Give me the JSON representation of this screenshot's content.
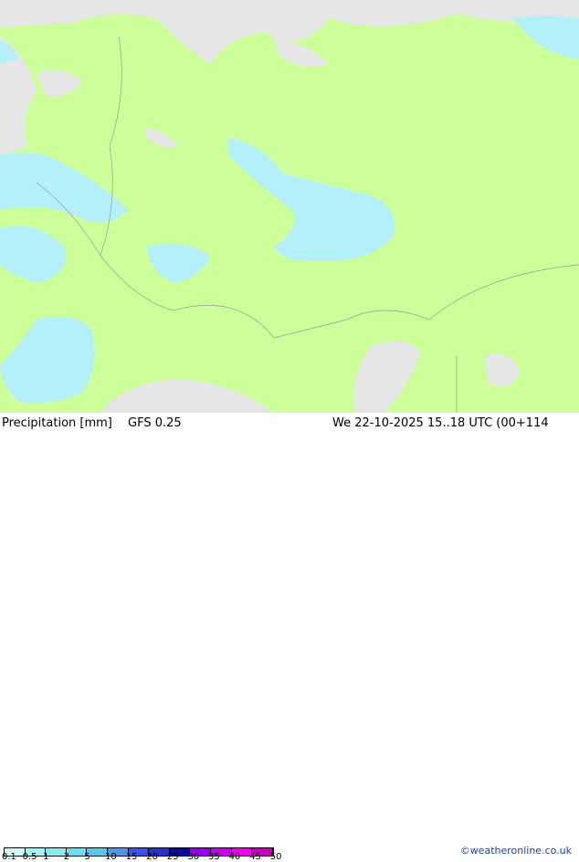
{
  "title": "Precipitation [mm]",
  "model": "GFS 0.25",
  "valid": "We 22-10-2025 15..18 UTC (00+114",
  "copyright": "©weatheronline.co.uk",
  "legend": {
    "ticks": [
      "0.1",
      "0.5",
      "1",
      "2",
      "5",
      "10",
      "15",
      "20",
      "25",
      "30",
      "35",
      "40",
      "45",
      "50"
    ],
    "colors": [
      "#d2fafa",
      "#a0f5f5",
      "#87ebeb",
      "#6edcf0",
      "#5ac8eb",
      "#5096e6",
      "#3c50f0",
      "#2832c8",
      "#0a0a9b",
      "#9b00f0",
      "#c800e6",
      "#f000e6",
      "#c800be"
    ]
  },
  "map": {
    "land_color": "#ccff99",
    "sea_color": "#e6e6e6",
    "precip_color": "#b4f0fa"
  }
}
